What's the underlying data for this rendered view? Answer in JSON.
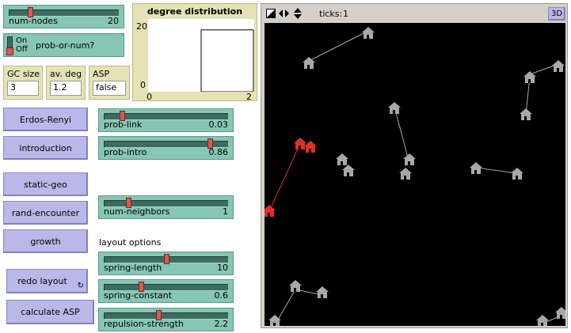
{
  "sliders": {
    "num_nodes": {
      "label": "num-nodes",
      "value": "20",
      "fraction": 0.2
    },
    "prob_link": {
      "label": "prob-link",
      "value": "0.03",
      "fraction": 0.1
    },
    "prob_intro": {
      "label": "prob-intro",
      "value": "0.86",
      "fraction": 0.86
    },
    "num_neighbors": {
      "label": "num-neighbors",
      "value": "1",
      "fraction": 0.1
    },
    "spring_length": {
      "label": "spring-length",
      "value": "10",
      "fraction": 0.5
    },
    "spring_constant": {
      "label": "spring-constant",
      "value": "0.6",
      "fraction": 0.3
    },
    "repulsion_strength": {
      "label": "repulsion-strength",
      "value": "2.2",
      "fraction": 0.44
    }
  },
  "switch": {
    "on_label": "On",
    "off_label": "Off",
    "label": "prob-or-num?",
    "state": "off"
  },
  "monitors": [
    {
      "label": "GC size",
      "value": "3"
    },
    {
      "label": "av. deg",
      "value": "1.2"
    },
    {
      "label": "ASP",
      "value": "false"
    }
  ],
  "buttons": {
    "erdos_renyi": "Erdos-Renyi",
    "introduction": "introduction",
    "static_geo": "static-geo",
    "rand_encounter": "rand-encounter",
    "growth": "growth",
    "redo_layout": "redo layout",
    "calculate_asp": "calculate ASP"
  },
  "layout_options_label": "layout options",
  "plot": {
    "title": "degree distribution",
    "y_max_label": "20",
    "y_min_label": "0",
    "x_min_label": "0",
    "x_max_label": "2"
  },
  "chart_data": {
    "type": "bar",
    "title": "degree distribution",
    "xlabel": "",
    "ylabel": "",
    "xlim": [
      0,
      2
    ],
    "ylim": [
      0,
      20
    ],
    "bars": [
      {
        "x_start": 0,
        "x_end": 1,
        "value": 0
      },
      {
        "x_start": 1,
        "x_end": 2,
        "value": 17
      }
    ]
  },
  "view": {
    "ticks_label": "ticks:",
    "ticks_value": "1",
    "three_d_label": "3D",
    "colors": {
      "background": "#000000",
      "node": "#a8a8a8",
      "highlight": "#e0302a"
    }
  }
}
